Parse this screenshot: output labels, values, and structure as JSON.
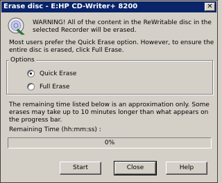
{
  "window": {
    "title": "Erase disc - E:HP CD-Writer+ 8200",
    "close_glyph": "✕"
  },
  "icons": {
    "disc": "disc-icon"
  },
  "messages": {
    "warning": "WARNING! All of the content in the ReWritable disc in the selected Recorder will be erased.",
    "description": "Most users prefer the Quick Erase option. However, to ensure the entire disc is erased, click Full Erase."
  },
  "options": {
    "legend": "Options",
    "quick_label": "Quick Erase",
    "full_label": "Full Erase",
    "selected": "quick"
  },
  "note": "The remaining time listed below is an approximation only. Some erases may take up to 10 minutes longer than what appears on the progress bar.",
  "remaining": {
    "label": "Remaining Time (hh:mm:ss) :"
  },
  "progress": {
    "text": "0%",
    "value": 0
  },
  "buttons": {
    "start": "Start",
    "close": "Close",
    "help": "Help"
  }
}
